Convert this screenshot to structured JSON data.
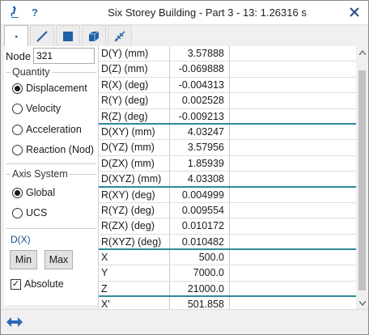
{
  "window": {
    "title": "Six Storey Building - Part 3 - 13: 1.26316 s",
    "help_label": "?",
    "close_icon": "close-icon",
    "app_icon": "microscope-icon"
  },
  "tabs": [
    {
      "name": "node-tab",
      "icon": "dot-icon",
      "active": true
    },
    {
      "name": "line-tab",
      "icon": "line-icon",
      "active": false
    },
    {
      "name": "plate-tab",
      "icon": "square-icon",
      "active": false
    },
    {
      "name": "brick-tab",
      "icon": "cube-icon",
      "active": false
    },
    {
      "name": "link-tab",
      "icon": "link-icon",
      "active": false
    }
  ],
  "node": {
    "label": "Node",
    "value": "321"
  },
  "quantity": {
    "title": "Quantity",
    "options": [
      "Displacement",
      "Velocity",
      "Acceleration",
      "Reaction (Nod)"
    ],
    "selected": "Displacement"
  },
  "axis": {
    "title": "Axis System",
    "options": [
      "Global",
      "UCS"
    ],
    "selected": "Global"
  },
  "dx": {
    "title": "D(X)",
    "min_label": "Min",
    "max_label": "Max",
    "absolute_label": "Absolute",
    "absolute_checked": true
  },
  "table": {
    "rows": [
      {
        "label": "D(Y) (mm)",
        "value": "3.57888"
      },
      {
        "label": "D(Z) (mm)",
        "value": "-0.069888"
      },
      {
        "label": "R(X) (deg)",
        "value": "-0.004313"
      },
      {
        "label": "R(Y) (deg)",
        "value": "0.002528"
      },
      {
        "label": "R(Z) (deg)",
        "value": "-0.009213"
      },
      {
        "label": "D(XY) (mm)",
        "value": "4.03247"
      },
      {
        "label": "D(YZ) (mm)",
        "value": "3.57956"
      },
      {
        "label": "D(ZX) (mm)",
        "value": "1.85939"
      },
      {
        "label": "D(XYZ) (mm)",
        "value": "4.03308"
      },
      {
        "label": "R(XY) (deg)",
        "value": "0.004999"
      },
      {
        "label": "R(YZ) (deg)",
        "value": "0.009554"
      },
      {
        "label": "R(ZX) (deg)",
        "value": "0.010172"
      },
      {
        "label": "R(XYZ) (deg)",
        "value": "0.010482"
      },
      {
        "label": "X",
        "value": "500.0"
      },
      {
        "label": "Y",
        "value": "7000.0"
      },
      {
        "label": "Z",
        "value": "21000.0"
      },
      {
        "label": "X'",
        "value": "501.858"
      }
    ],
    "separator_after": [
      4,
      8,
      12,
      15
    ]
  },
  "colors": {
    "separator": "#2f8a9a",
    "accent_blue": "#1a4f8a",
    "icon_blue": "#2a6ab8"
  }
}
